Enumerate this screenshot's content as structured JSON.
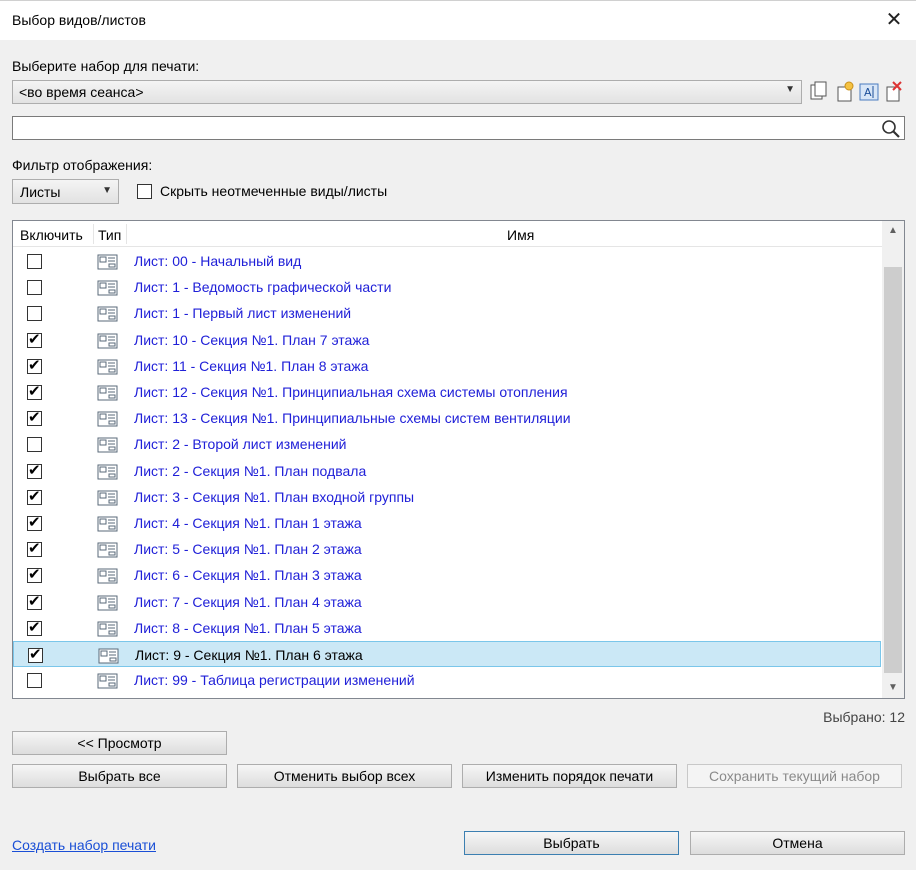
{
  "window": {
    "title": "Выбор видов/листов"
  },
  "print_set": {
    "label": "Выберите набор для печати:",
    "selected": "<во время сеанса>",
    "toolbar_icons": [
      "duplicate-icon",
      "new-set-icon",
      "rename-icon",
      "delete-icon"
    ]
  },
  "search": {
    "value": "",
    "placeholder": ""
  },
  "filter": {
    "label": "Фильтр отображения:",
    "selected": "Листы",
    "hide_unchecked_label": "Скрыть неотмеченные виды/листы",
    "hide_unchecked": false
  },
  "grid": {
    "columns": [
      "Включить",
      "Тип",
      "Имя"
    ],
    "rows": [
      {
        "checked": false,
        "type": "sheet-icon",
        "name": "Лист: 00 - Начальный вид"
      },
      {
        "checked": false,
        "type": "sheet-icon",
        "name": "Лист: 1 - Ведомость графической части"
      },
      {
        "checked": false,
        "type": "sheet-icon",
        "name": "Лист: 1 - Первый лист изменений"
      },
      {
        "checked": true,
        "type": "sheet-icon",
        "name": "Лист: 10 - Секция №1. План 7 этажа"
      },
      {
        "checked": true,
        "type": "sheet-icon",
        "name": "Лист: 11 - Секция №1. План 8 этажа"
      },
      {
        "checked": true,
        "type": "sheet-icon",
        "name": "Лист: 12 - Секция №1. Принципиальная схема системы отопления"
      },
      {
        "checked": true,
        "type": "sheet-icon",
        "name": "Лист: 13 - Секция №1. Принципиальные схемы систем вентиляции"
      },
      {
        "checked": false,
        "type": "sheet-icon",
        "name": "Лист: 2 - Второй лист изменений"
      },
      {
        "checked": true,
        "type": "sheet-icon",
        "name": "Лист: 2 - Секция №1. План подвала"
      },
      {
        "checked": true,
        "type": "sheet-icon",
        "name": "Лист: 3 - Секция №1. План входной группы"
      },
      {
        "checked": true,
        "type": "sheet-icon",
        "name": "Лист: 4 - Секция №1. План 1 этажа"
      },
      {
        "checked": true,
        "type": "sheet-icon",
        "name": "Лист: 5 - Секция №1. План 2 этажа"
      },
      {
        "checked": true,
        "type": "sheet-icon",
        "name": "Лист: 6 - Секция №1. План 3 этажа"
      },
      {
        "checked": true,
        "type": "sheet-icon",
        "name": "Лист: 7 - Секция №1. План 4 этажа"
      },
      {
        "checked": true,
        "type": "sheet-icon",
        "name": "Лист: 8 - Секция №1. План 5 этажа"
      },
      {
        "checked": true,
        "type": "sheet-icon",
        "name": "Лист: 9 - Секция №1. План 6 этажа",
        "selected": true
      },
      {
        "checked": false,
        "type": "sheet-icon",
        "name": "Лист: 99 - Таблица регистрации изменений"
      }
    ]
  },
  "selected_count": "Выбрано: 12",
  "buttons": {
    "preview": "<< Просмотр",
    "select_all": "Выбрать все",
    "deselect_all": "Отменить выбор всех",
    "change_order": "Изменить порядок печати",
    "save_set": "Сохранить текущий набор",
    "ok": "Выбрать",
    "cancel": "Отмена"
  },
  "create_set_link": "Создать набор печати",
  "colors": {
    "row_text": "#2020d8",
    "selection_bg": "#cbe8f6",
    "link": "#1a4fd6"
  }
}
